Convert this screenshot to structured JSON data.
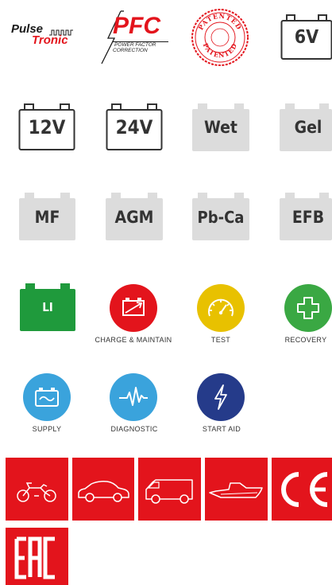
{
  "brand": {
    "pulse_word1": "Pulse",
    "pulse_word2": "Tronic",
    "pfc_title": "PFC",
    "pfc_line1": "POWER FACTOR",
    "pfc_line2": "CORRECTION",
    "patented_top": "PATENTED",
    "patented_bottom": "PATENTED"
  },
  "voltages": [
    "6V",
    "12V",
    "24V"
  ],
  "battery_types": [
    "Wet",
    "Gel",
    "MF",
    "AGM",
    "Pb-Ca",
    "EFB"
  ],
  "li_label": "LI",
  "modes": [
    {
      "label": "CHARGE & MAINTAIN",
      "color": "#e3141c",
      "icon": "battery-charge-icon"
    },
    {
      "label": "TEST",
      "color": "#e8c100",
      "icon": "gauge-icon"
    },
    {
      "label": "RECOVERY",
      "color": "#3aa843",
      "icon": "cross-icon"
    },
    {
      "label": "SUPPLY",
      "color": "#3aa3dc",
      "icon": "supply-battery-icon"
    },
    {
      "label": "DIAGNOSTIC",
      "color": "#3aa3dc",
      "icon": "pulse-wave-icon"
    },
    {
      "label": "START AID",
      "color": "#253b8a",
      "icon": "lightning-icon"
    }
  ],
  "vehicles": [
    "motorcycle-icon",
    "car-icon",
    "van-icon",
    "boat-icon"
  ],
  "certs": {
    "ce": "CE",
    "eac": "EAC"
  },
  "colors": {
    "red": "#e3141c",
    "green": "#1f9a3c",
    "grey_battery": "#dcdcdc",
    "dark": "#333333"
  }
}
